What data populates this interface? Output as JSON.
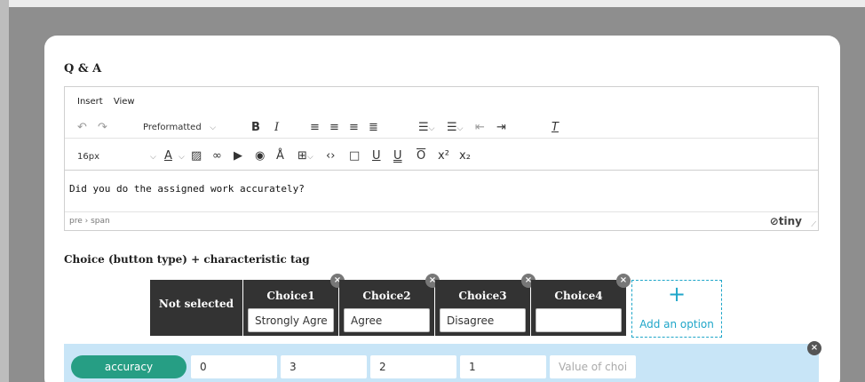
{
  "qa_title": "Q & A",
  "editor": {
    "menu": [
      "Insert",
      "View"
    ],
    "block_format": "Preformatted",
    "font_size": "16px",
    "content": "Did you do the assigned work accurately?",
    "path": "pre › span",
    "brand": "tiny"
  },
  "choice_section": {
    "title": "Choice (button type) + characteristic tag",
    "not_selected_label": "Not selected",
    "choices": [
      {
        "label": "Choice1",
        "value": "Strongly Agree"
      },
      {
        "label": "Choice2",
        "value": "Agree"
      },
      {
        "label": "Choice3",
        "value": "Disagree"
      },
      {
        "label": "Choice4",
        "value": ""
      }
    ],
    "add_option_label": "Add an option"
  },
  "tag_row": {
    "tag": "accuracy",
    "values": [
      "0",
      "3",
      "2",
      "1"
    ],
    "value_placeholder": "Value of choi"
  },
  "colors": {
    "accent": "#1fa6c9",
    "tag": "#269e84",
    "tag_row_bg": "#c8e5f7",
    "dark_button": "#333333"
  }
}
